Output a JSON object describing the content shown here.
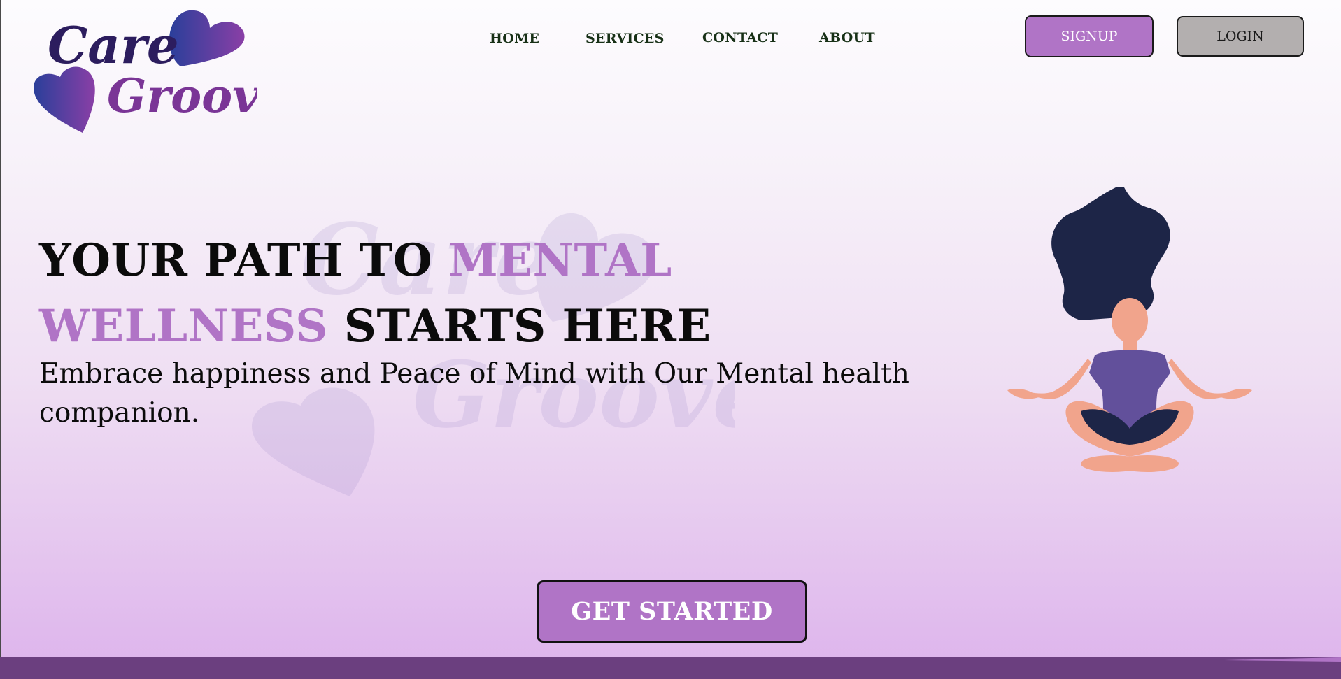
{
  "brand": {
    "line1": "Care",
    "line2": "Groove"
  },
  "nav": {
    "items": [
      {
        "label": "HOME"
      },
      {
        "label": "SERVICES"
      },
      {
        "label": "CONTACT"
      },
      {
        "label": "ABOUT"
      }
    ],
    "signup_label": "SIGNUP",
    "login_label": "LOGIN"
  },
  "hero": {
    "title_part1": "YOUR PATH TO ",
    "title_accent1": "MENTAL",
    "title_accent2": "WELLNESS",
    "title_part2": " STARTS HERE",
    "subtitle": "Embrace happiness and Peace of Mind with Our Mental health companion.",
    "cta_label": "GET STARTED"
  },
  "colors": {
    "accent": "#b074c6",
    "nav_text": "#173016",
    "band": "#6b3f7f",
    "logo_text": "#2c1d5e"
  },
  "icons": {
    "logo": "heart-logo-icon",
    "illustration": "meditating-woman-illustration"
  }
}
